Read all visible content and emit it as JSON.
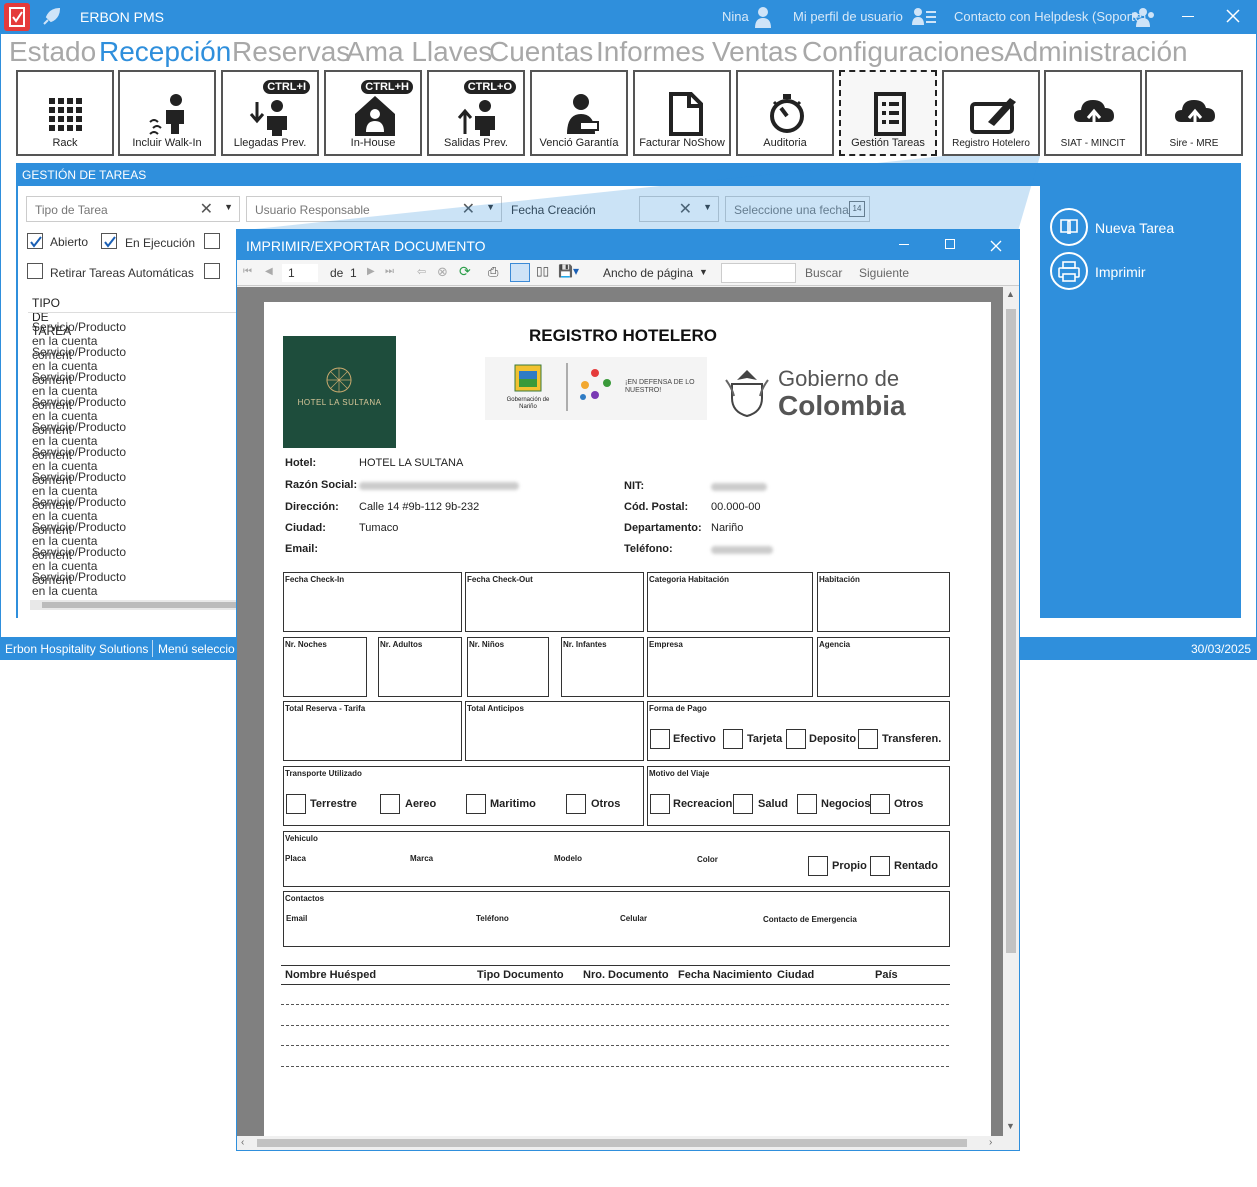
{
  "app": {
    "title": "ERBON PMS",
    "user": "Nina",
    "profile_link": "Mi perfil de usuario",
    "helpdesk_link": "Contacto con Helpdesk (Soporte)"
  },
  "menu": [
    "Estado",
    "Recepción",
    "Reservas",
    "Ama Llaves",
    "Cuentas",
    "Informes",
    "Ventas",
    "Configuraciones",
    "Administración"
  ],
  "toolbar": [
    {
      "label": "Rack",
      "icon": "rack-grid-icon",
      "badge": ""
    },
    {
      "label": "Incluir Walk-In",
      "icon": "walk-in-icon",
      "badge": ""
    },
    {
      "label": "Llegadas Prev.",
      "icon": "arrivals-icon",
      "badge": "CTRL+I"
    },
    {
      "label": "In-House",
      "icon": "in-house-icon",
      "badge": "CTRL+H"
    },
    {
      "label": "Salidas Prev.",
      "icon": "departures-icon",
      "badge": "CTRL+O"
    },
    {
      "label": "Venció Garantía",
      "icon": "guarantee-expired-icon",
      "badge": ""
    },
    {
      "label": "Facturar NoShow",
      "icon": "invoice-noshow-icon",
      "badge": ""
    },
    {
      "label": "Auditoria",
      "icon": "audit-icon",
      "badge": ""
    },
    {
      "label": "Gestión Tareas",
      "icon": "task-list-icon",
      "badge": ""
    },
    {
      "label": "Registro Hotelero",
      "icon": "hotel-register-icon",
      "badge": ""
    },
    {
      "label": "SIAT - MINCIT",
      "icon": "cloud-upload-icon",
      "badge": ""
    },
    {
      "label": "Sire - MRE",
      "icon": "cloud-upload-icon",
      "badge": ""
    }
  ],
  "tasks": {
    "header": "GESTIÓN DE TAREAS",
    "filter_task_type": "Tipo de Tarea",
    "filter_responsible": "Usuario Responsable",
    "date_label": "Fecha Creación",
    "date_placeholder": "Seleccione una fecha",
    "date_icon_day": "14",
    "check_open": "Abierto",
    "check_running": "En Ejecución",
    "check_auto": "Retirar Tareas Automáticas",
    "list_header": "TIPO DE TAREA",
    "rows": [
      "Servicio/Producto en la cuenta corrient",
      "Servicio/Producto en la cuenta corrient",
      "Servicio/Producto en la cuenta corrient",
      "Servicio/Producto en la cuenta corrient",
      "Servicio/Producto en la cuenta corrient",
      "Servicio/Producto en la cuenta corrient",
      "Servicio/Producto en la cuenta corrient",
      "Servicio/Producto en la cuenta corrient",
      "Servicio/Producto en la cuenta corrient",
      "Servicio/Producto en la cuenta corrient",
      "Servicio/Producto en la cuenta corrient"
    ]
  },
  "right_panel": {
    "new_task": "Nueva Tarea",
    "print": "Imprimir"
  },
  "status": {
    "company": "Erbon Hospitality Solutions",
    "menu_selected": "Menú seleccio",
    "date": "30/03/2025"
  },
  "dialog": {
    "title": "IMPRIMIR/EXPORTAR DOCUMENTO",
    "page_current": "1",
    "page_of": "de",
    "page_total": "1",
    "zoom": "Ancho de página",
    "search": "Buscar",
    "next": "Siguiente"
  },
  "report": {
    "title": "REGISTRO HOTELERO",
    "logo_text": "HOTEL LA SULTANA",
    "gov_text1": "Gobierno de",
    "gov_text2": "Colombia",
    "narino_text1": "Gobernación de Nariño",
    "narino_text2": "¡EN DEFENSA DE LO NUESTRO!",
    "hotel_label": "Hotel:",
    "hotel_value": "HOTEL LA SULTANA",
    "razon_label": "Razón Social:",
    "nit_label": "NIT:",
    "dir_label": "Dirección:",
    "dir_value": "Calle 14 #9b-112 9b-232",
    "postal_label": "Cód. Postal:",
    "postal_value": "00.000-00",
    "city_label": "Ciudad:",
    "city_value": "Tumaco",
    "dept_label": "Departamento:",
    "dept_value": "Nariño",
    "email_label": "Email:",
    "phone_label": "Teléfono:",
    "boxes": {
      "checkin": "Fecha Check-In",
      "checkout": "Fecha Check-Out",
      "category": "Categoria Habitación",
      "room": "Habitación",
      "nights": "Nr. Noches",
      "adults": "Nr. Adultos",
      "kids": "Nr. Niños",
      "infants": "Nr. Infantes",
      "company": "Empresa",
      "agency": "Agencia",
      "total": "Total Reserva - Tarifa",
      "advances": "Total Anticipos",
      "payment": "Forma de Pago",
      "transport": "Transporte Utilizado",
      "reason": "Motivo del Viaje",
      "vehicle": "Vehiculo",
      "plate": "Placa",
      "brand": "Marca",
      "model": "Modelo",
      "color": "Color",
      "contacts": "Contactos",
      "c_email": "Email",
      "c_phone": "Teléfono",
      "c_cell": "Celular",
      "c_emerg": "Contacto de Emergencia"
    },
    "payment_opts": [
      "Efectivo",
      "Tarjeta",
      "Deposito",
      "Transferen."
    ],
    "transport_opts": [
      "Terrestre",
      "Aereo",
      "Maritimo",
      "Otros"
    ],
    "reason_opts": [
      "Recreacion",
      "Salud",
      "Negocios",
      "Otros"
    ],
    "vehicle_opts": [
      "Propio",
      "Rentado"
    ],
    "guest_cols": [
      "Nombre Huésped",
      "Tipo Documento",
      "Nro. Documento",
      "Fecha Nacimiento",
      "Ciudad",
      "País"
    ]
  },
  "colors": {
    "accent": "#2f8fdc",
    "menu_active": "#2f8fdc",
    "menu_inactive": "#a8a8a8",
    "logo_green": "#1e4d3c"
  }
}
